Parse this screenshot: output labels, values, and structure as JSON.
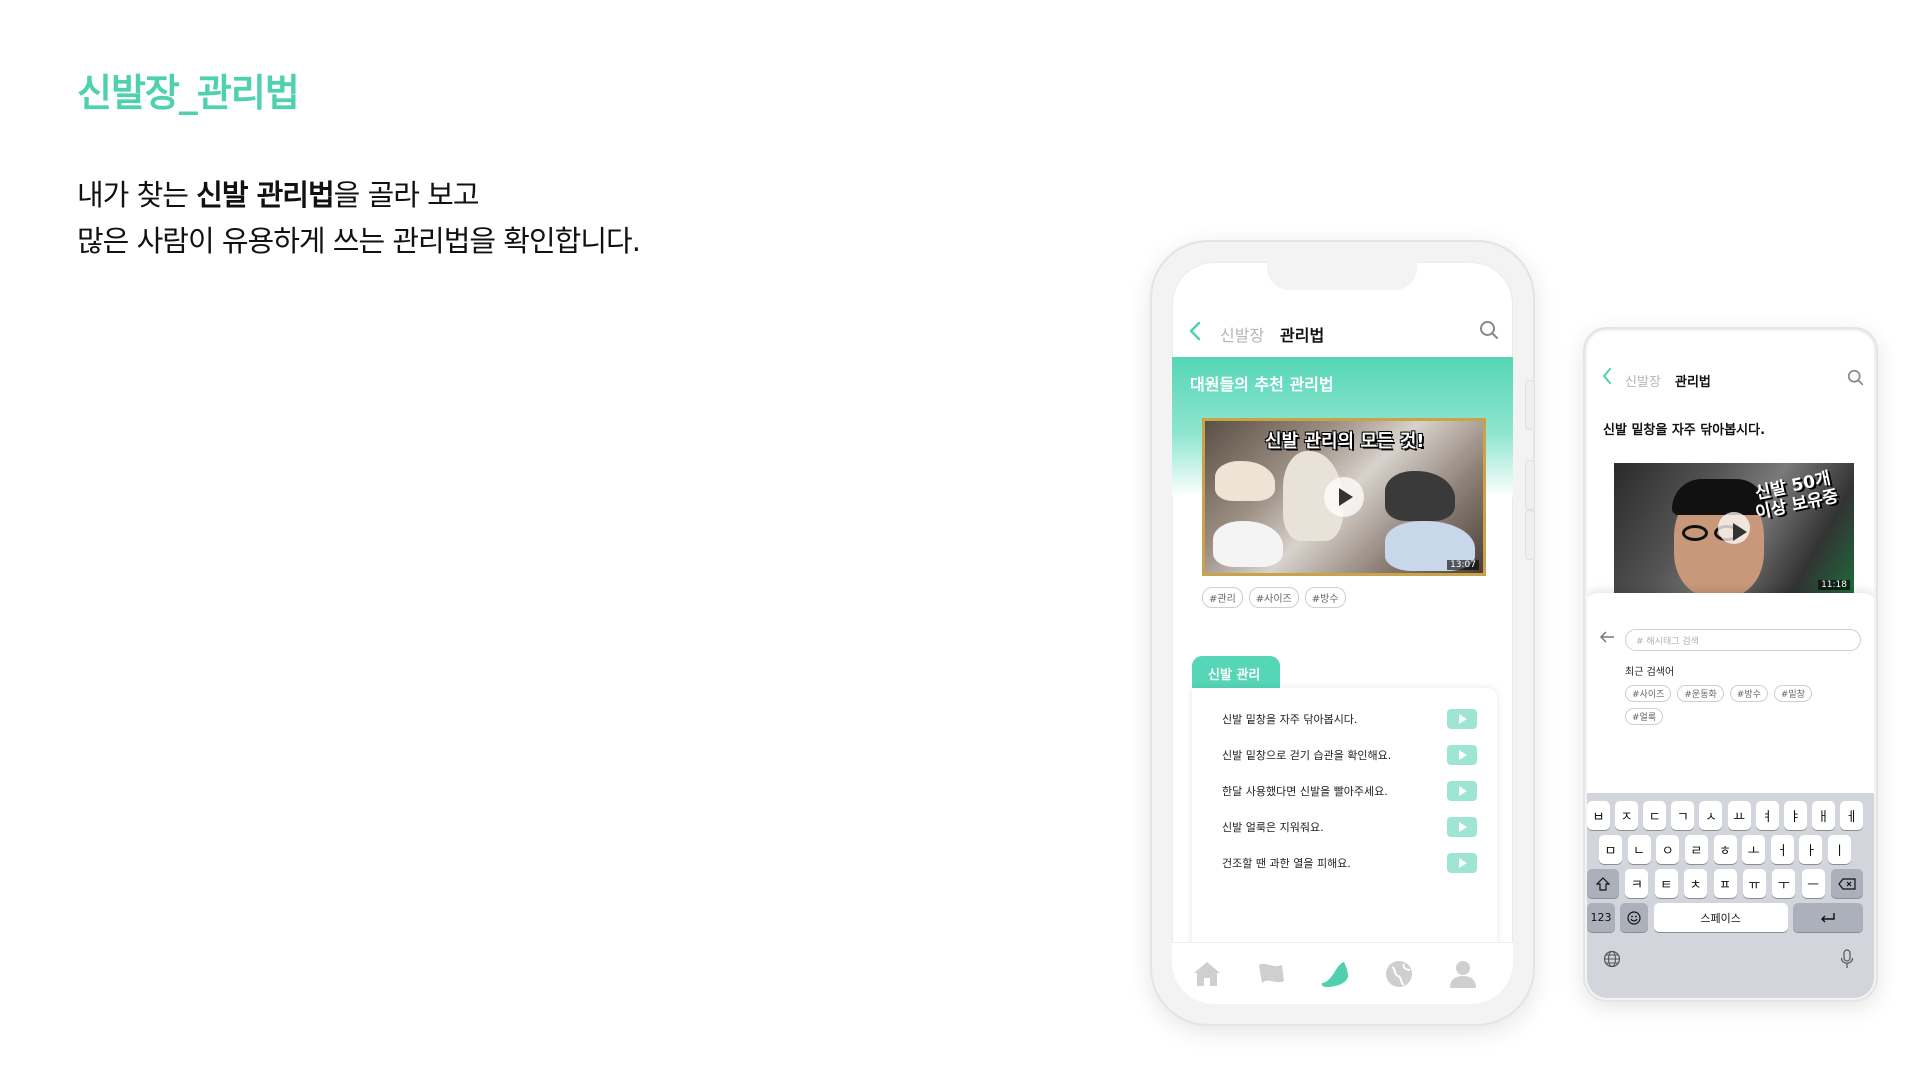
{
  "slide": {
    "title": "신발장_관리법",
    "intro_line1_prefix": "내가 찾는 ",
    "intro_line1_bold": "신발 관리법",
    "intro_line1_suffix": "을 골라 보고",
    "intro_line2": "많은 사람이 유용하게 쓰는 관리법을 확인합니다."
  },
  "phone1": {
    "breadcrumb_parent": "신발장",
    "breadcrumb_current": "관리법",
    "banner_title": "대원들의 추천 관리법",
    "video_title": "신발 관리의 모든 것!",
    "video_duration": "13:07",
    "video_tags": [
      "#관리",
      "#사이즈",
      "#방수"
    ],
    "category_tab": "신발 관리",
    "tips": [
      "신발 밑창을 자주 닦아봅시다.",
      "신발 밑창으로 걷기 습관을 확인해요.",
      "한달 사용했다면 신발을 빨아주세요.",
      "신발 얼룩은 지워줘요.",
      "건조할 땐 과한 열을 피해요."
    ],
    "tabbar_icons": [
      "home-icon",
      "flag-icon",
      "shoe-icon",
      "globe-icon",
      "user-icon"
    ],
    "accent_color": "#55d6b6"
  },
  "phone2": {
    "breadcrumb_parent": "신발장",
    "breadcrumb_current": "관리법",
    "heading": "신발 밑창을 자주 닦아봅시다.",
    "video_title": "신발 50개 이상 보유중",
    "video_duration": "11:18",
    "search_placeholder": "# 해시태그 검색",
    "recent_label": "최근 검색어",
    "recent_tags": [
      "#사이즈",
      "#운동화",
      "#방수",
      "#밑창",
      "#얼룩"
    ],
    "keyboard": {
      "row1": [
        "ㅂ",
        "ㅈ",
        "ㄷ",
        "ㄱ",
        "ㅅ",
        "ㅛ",
        "ㅕ",
        "ㅑ",
        "ㅐ",
        "ㅔ"
      ],
      "row2": [
        "ㅁ",
        "ㄴ",
        "ㅇ",
        "ㄹ",
        "ㅎ",
        "ㅗ",
        "ㅓ",
        "ㅏ",
        "ㅣ"
      ],
      "row3": [
        "ㅋ",
        "ㅌ",
        "ㅊ",
        "ㅍ",
        "ㅠ",
        "ㅜ",
        "ㅡ"
      ],
      "numbers_key": "123",
      "space_key": "스페이스"
    }
  }
}
